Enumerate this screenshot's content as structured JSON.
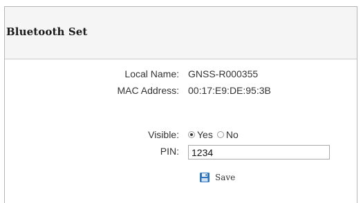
{
  "panel": {
    "title": "Bluetooth Set"
  },
  "info": {
    "local_name_label": "Local Name:",
    "local_name_value": "GNSS-R000355",
    "mac_address_label": "MAC Address:",
    "mac_address_value": "00:17:E9:DE:95:3B"
  },
  "visible": {
    "label": "Visible:",
    "options": [
      {
        "label": "Yes",
        "selected": true
      },
      {
        "label": "No",
        "selected": false
      }
    ]
  },
  "pin": {
    "label": "PIN:",
    "value": "1234"
  },
  "save": {
    "label": "Save",
    "icon": "save-icon"
  },
  "colors": {
    "header_bg": "#f5f5f5",
    "border": "#b5b5b5",
    "save_icon_blue": "#2f74c0"
  }
}
